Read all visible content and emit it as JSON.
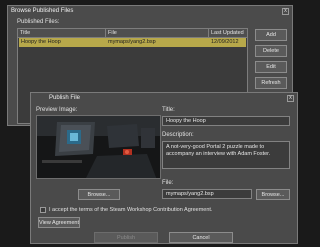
{
  "browse_window": {
    "title": "Browse Published Files",
    "section_label": "Published Files:",
    "columns": [
      "Title",
      "File",
      "Last Updated"
    ],
    "rows": [
      {
        "title": "Hoopy the Hoop",
        "file": "mymaps/yang2.bsp",
        "last_updated": "12/09/2012"
      }
    ],
    "buttons": {
      "add": "Add",
      "delete": "Delete",
      "edit": "Edit",
      "refresh": "Refresh"
    },
    "close_glyph": "x"
  },
  "publish_window": {
    "title": "Publish File",
    "preview_label": "Preview Image:",
    "title_label": "Title:",
    "title_value": "Hoopy the Hoop",
    "description_label": "Description:",
    "description_value": "A not-very-good Portal 2 puzzle made to accompany an interview with Adam Foster.",
    "file_label": "File:",
    "file_value": "mymaps/yang2.bsp",
    "browse_preview": "Browse...",
    "browse_file": "Browse...",
    "agreement_text": "I accept the terms of the Steam Workshop Contribution Agreement.",
    "view_agreement": "View Agreement",
    "publish": "Publish",
    "cancel": "Cancel",
    "close_glyph": "x"
  },
  "colors": {
    "window_bg": "#4b4b4b",
    "selected_row": "#b7a84a",
    "border": "#7a7a7a"
  }
}
